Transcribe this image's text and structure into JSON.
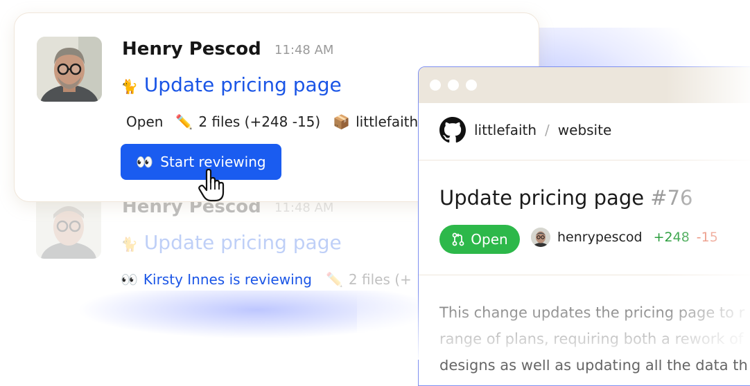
{
  "message": {
    "author": "Henry Pescod",
    "time": "11:48 AM",
    "title_emoji": "🐈",
    "title": "Update pricing page",
    "status": "Open",
    "files_emoji": "✏️",
    "files": "2 files (+248 -15)",
    "repo_emoji": "📦",
    "repo_short": "littlefaith",
    "button_emoji": "👀",
    "button_label": "Start reviewing"
  },
  "ghost_message": {
    "author": "Henry Pescod",
    "time": "11:48 AM",
    "title_emoji": "🐈",
    "title": "Update pricing page",
    "reviewer_emoji": "👀",
    "reviewer_text": "Kirsty Innes is reviewing",
    "files_emoji": "✏️",
    "files": "2 files (+"
  },
  "github": {
    "owner": "littlefaith",
    "separator": "/",
    "repo": "website",
    "pr_title": "Update pricing page",
    "pr_number": "#76",
    "status": "Open",
    "author": "henrypescod",
    "additions": "+248",
    "deletions": "-15",
    "description_lines": [
      "This change updates the pricing page to r",
      "range of plans, requiring both a rework of",
      "designs as well as updating all the data th"
    ]
  },
  "colors": {
    "accent_blue": "#1a5cf0",
    "link_blue": "#1a55e6",
    "open_green": "#2db84a",
    "addition_green": "#2a9d3c",
    "deletion_red": "#e05a3a"
  }
}
